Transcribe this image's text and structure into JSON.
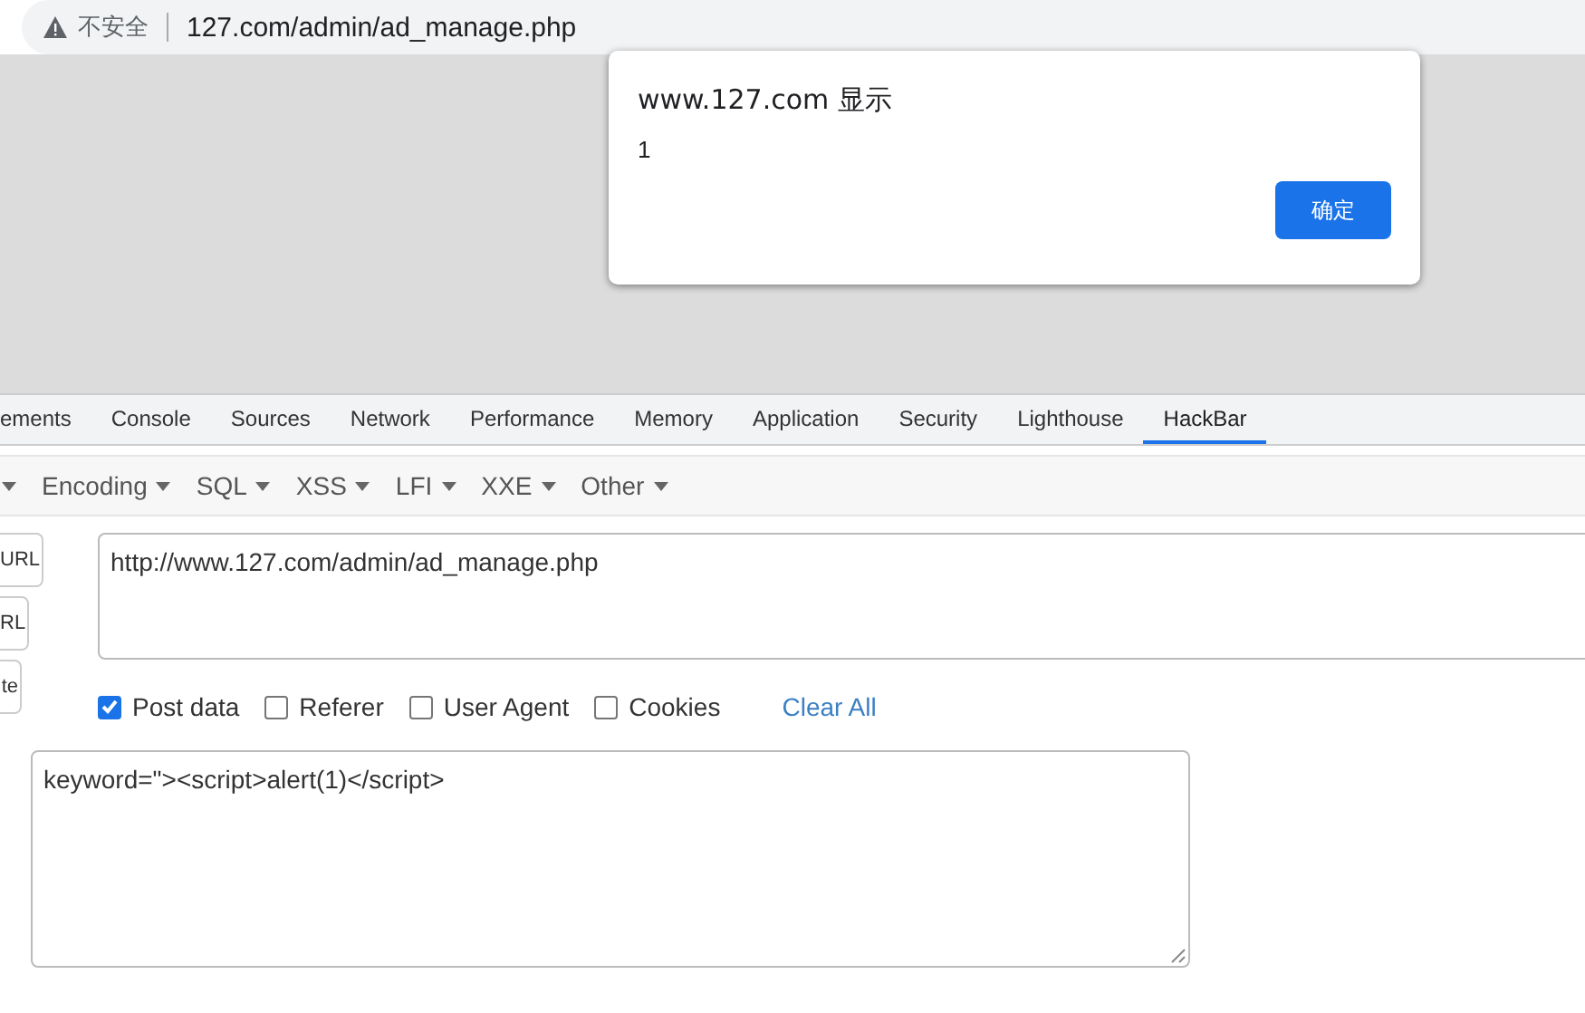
{
  "address_bar": {
    "security_label": "不安全",
    "url": "127.com/admin/ad_manage.php"
  },
  "dialog": {
    "title": "www.127.com 显示",
    "message": "1",
    "ok_button": "确定"
  },
  "devtools_tabs": [
    {
      "label": "ements",
      "selected": false
    },
    {
      "label": "Console",
      "selected": false
    },
    {
      "label": "Sources",
      "selected": false
    },
    {
      "label": "Network",
      "selected": false
    },
    {
      "label": "Performance",
      "selected": false
    },
    {
      "label": "Memory",
      "selected": false
    },
    {
      "label": "Application",
      "selected": false
    },
    {
      "label": "Security",
      "selected": false
    },
    {
      "label": "Lighthouse",
      "selected": false
    },
    {
      "label": "HackBar",
      "selected": true
    }
  ],
  "hackbar_menu": [
    {
      "label": "Encoding"
    },
    {
      "label": "SQL"
    },
    {
      "label": "XSS"
    },
    {
      "label": "LFI"
    },
    {
      "label": "XXE"
    },
    {
      "label": "Other"
    }
  ],
  "side_buttons": [
    "URL",
    "RL",
    "te"
  ],
  "url_field": {
    "value": "http://www.127.com/admin/ad_manage.php"
  },
  "options": [
    {
      "label": "Post data",
      "checked": true
    },
    {
      "label": "Referer",
      "checked": false
    },
    {
      "label": "User Agent",
      "checked": false
    },
    {
      "label": "Cookies",
      "checked": false
    }
  ],
  "clear_all": "Clear All",
  "post_field": {
    "value": "keyword=\"><script>alert(1)</script>"
  }
}
